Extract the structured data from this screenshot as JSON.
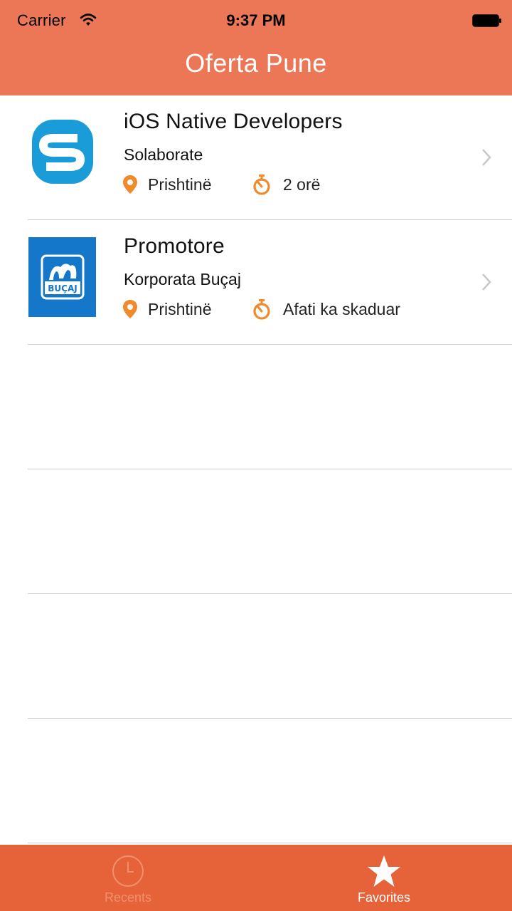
{
  "status_bar": {
    "carrier": "Carrier",
    "time": "9:37 PM",
    "wifi_icon": "wifi-icon",
    "battery_icon": "battery-icon"
  },
  "nav": {
    "title": "Oferta Pune"
  },
  "jobs": [
    {
      "title": "iOS Native Developers",
      "company": "Solaborate",
      "location": "Prishtinë",
      "deadline": "2 orë",
      "logo": "solaborate-logo"
    },
    {
      "title": "Promotore",
      "company": "Korporata Buçaj",
      "location": "Prishtinë",
      "deadline": "Afati ka skaduar",
      "logo": "bucaj-logo",
      "logo_text": "BUÇAJ"
    }
  ],
  "tabbar": {
    "tabs": [
      {
        "label": "Recents",
        "icon": "clock-icon",
        "selected": false
      },
      {
        "label": "Favorites",
        "icon": "star-icon",
        "selected": true
      }
    ]
  },
  "colors": {
    "header": "#EC7756",
    "tabbar": "#E66238",
    "accent_orange": "#F08A2A",
    "solaborate_blue": "#1A9CD8",
    "bucaj_blue": "#1577C9"
  }
}
